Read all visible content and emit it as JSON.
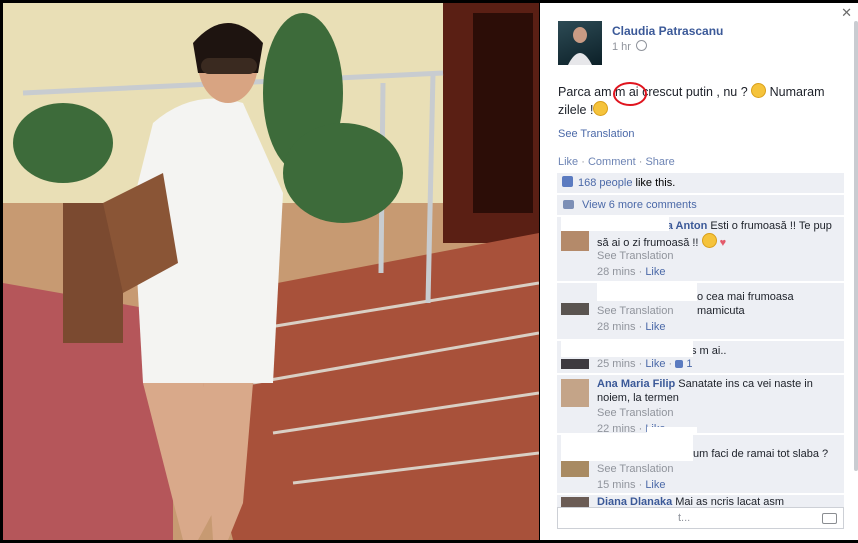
{
  "post": {
    "author": "Claudia Patrascanu",
    "time": "1 hr",
    "text_part1": "Parca am ",
    "text_part2": "m ai",
    "text_part3": " crescut putin , nu ? ",
    "text_part4": " Numaram zilele !",
    "see_translation": "See Translation",
    "actions": {
      "like": "Like",
      "sep1": " · ",
      "comment": "Comment",
      "sep2": " · ",
      "share": "Share"
    },
    "likes_count": "168 people",
    "likes_suffix": " like this.",
    "view_more": "View 6 more comments"
  },
  "comments": [
    {
      "name": "eta Anton",
      "text": " Esti o frumoasă !! Te pup să ai o zi frumoasă !! ",
      "see": "See Translation",
      "time": "28 mins",
      "like": "Like"
    },
    {
      "name": "",
      "text": "o cea mai frumoasa mamicuta",
      "see": "See Translation",
      "time": "28 mins",
      "like": "Like"
    },
    {
      "name": "",
      "text": "s m ai..",
      "see": "",
      "time": "25 mins",
      "like": "Like",
      "likes": "1"
    },
    {
      "name": "Ana Maria Filip",
      "text": " Sanatate ins ca vei naste in noiem, la termen",
      "see": "See Translation",
      "time": "22 mins",
      "like": "Like"
    },
    {
      "name": "",
      "text": "um faci de ramai tot slaba ?",
      "see": "See Translation",
      "time": "15 mins",
      "like": "Like"
    },
    {
      "name": "Diana Dlanaka",
      "text": " Mai as ncris lacat asm",
      "see": "",
      "time": "",
      "like": ""
    }
  ],
  "write_placeholder": "t...",
  "colors": {
    "link": "#3b5998",
    "box": "#edeff4",
    "highlight": "#e0141e"
  }
}
